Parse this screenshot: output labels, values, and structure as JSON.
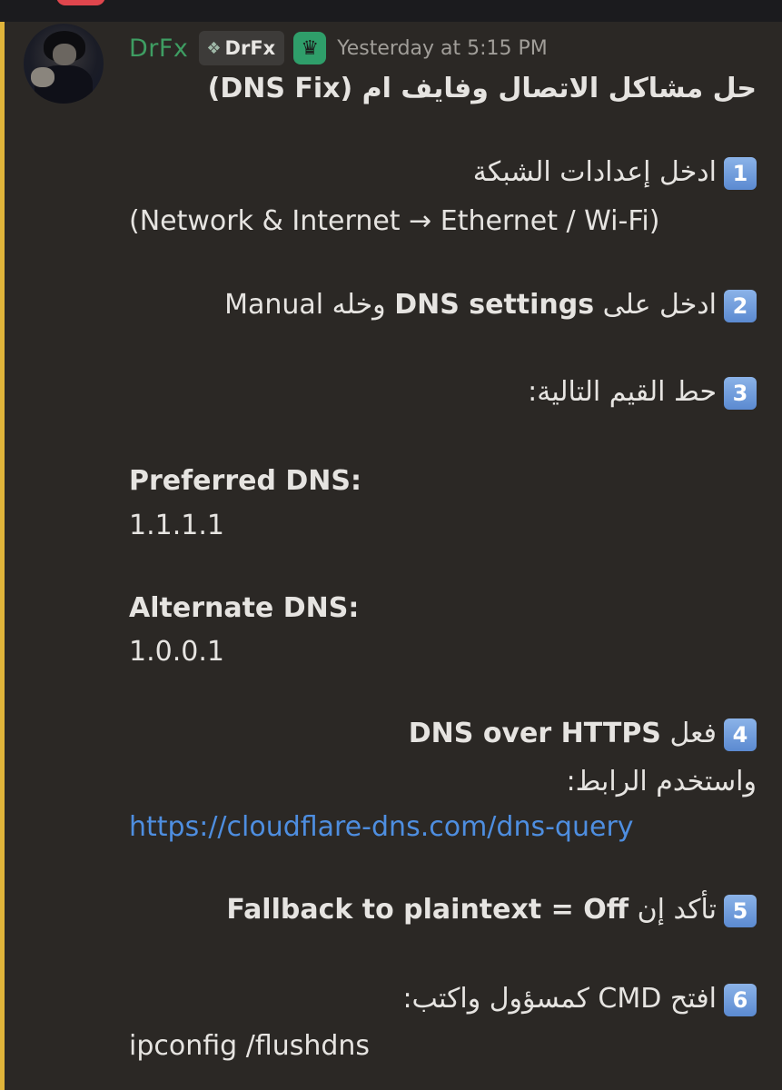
{
  "message": {
    "author": "DrFx",
    "tag": "DrFx",
    "timestamp": "Yesterday at 5:15 PM",
    "title": "حل مشاكل الاتصال وفايف ام (DNS Fix)",
    "step1": {
      "num": "1",
      "text": "ادخل إعدادات الشبكة",
      "path": "(Network & Internet → Ethernet / Wi-Fi)"
    },
    "step2": {
      "num": "2",
      "pre": "ادخل على ",
      "bold": "DNS settings",
      "post": " وخله Manual"
    },
    "step3": {
      "num": "3",
      "text": "حط القيم التالية:"
    },
    "preferred_label": "Preferred DNS:",
    "preferred_value": "1.1.1.1",
    "alternate_label": "Alternate DNS:",
    "alternate_value": "1.0.0.1",
    "step4": {
      "num": "4",
      "pre": "فعل ",
      "bold": "DNS over HTTPS",
      "note": "واستخدم الرابط:",
      "link": "https://cloudflare-dns.com/dns-query"
    },
    "step5": {
      "num": "5",
      "pre": "تأكد إن ",
      "bold": "Fallback to plaintext = Off"
    },
    "step6": {
      "num": "6",
      "text": "افتح CMD كمسؤول واكتب:",
      "command": "ipconfig /flushdns"
    }
  },
  "icons": {
    "tag_icon": "diamond-icon",
    "role_icon": "crown-icon"
  },
  "colors": {
    "username": "#3e9d62",
    "link": "#4e8ee0",
    "mention_bar": "#e0b43a",
    "background": "#2b2825"
  }
}
